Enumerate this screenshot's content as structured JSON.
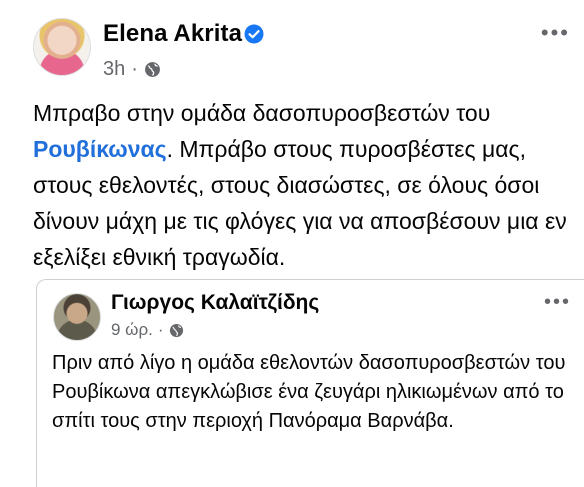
{
  "post": {
    "author": "Elena Akrita",
    "time": "3h",
    "dot": "·",
    "more_label": "•••",
    "text_before": "Μπραβο στην ομάδα δασοπυροσβεστών του ",
    "mention": "Ρουβίκωνας",
    "text_after": ". Μπράβο στους πυροσβέστες μας, στους εθελοντές, στους διασώστες, σε όλους όσοι δίνουν μάχη με τις φλόγες για να αποσβέσουν μια εν εξελίξει εθνική τραγωδία."
  },
  "shared": {
    "author": "Γιωργος Καλαϊτζίδης",
    "time": "9 ώρ.",
    "dot": "·",
    "more_label": "•••",
    "text": "Πριν από λίγο η ομάδα εθελοντών δασοπυροσβεστών του Ρουβίκωνα απεγκλώβισε ένα ζευγάρι ηλικιωμένων από το σπίτι τους στην περιοχή Πανόραμα Βαρνάβα."
  },
  "icons": {
    "verified": "verified-badge-icon",
    "audience": "globe-icon",
    "more": "more-options-icon"
  },
  "colors": {
    "mention": "#216fdb",
    "verified": "#1877f2",
    "secondary_text": "#65676b",
    "divider": "#ced0d4"
  }
}
